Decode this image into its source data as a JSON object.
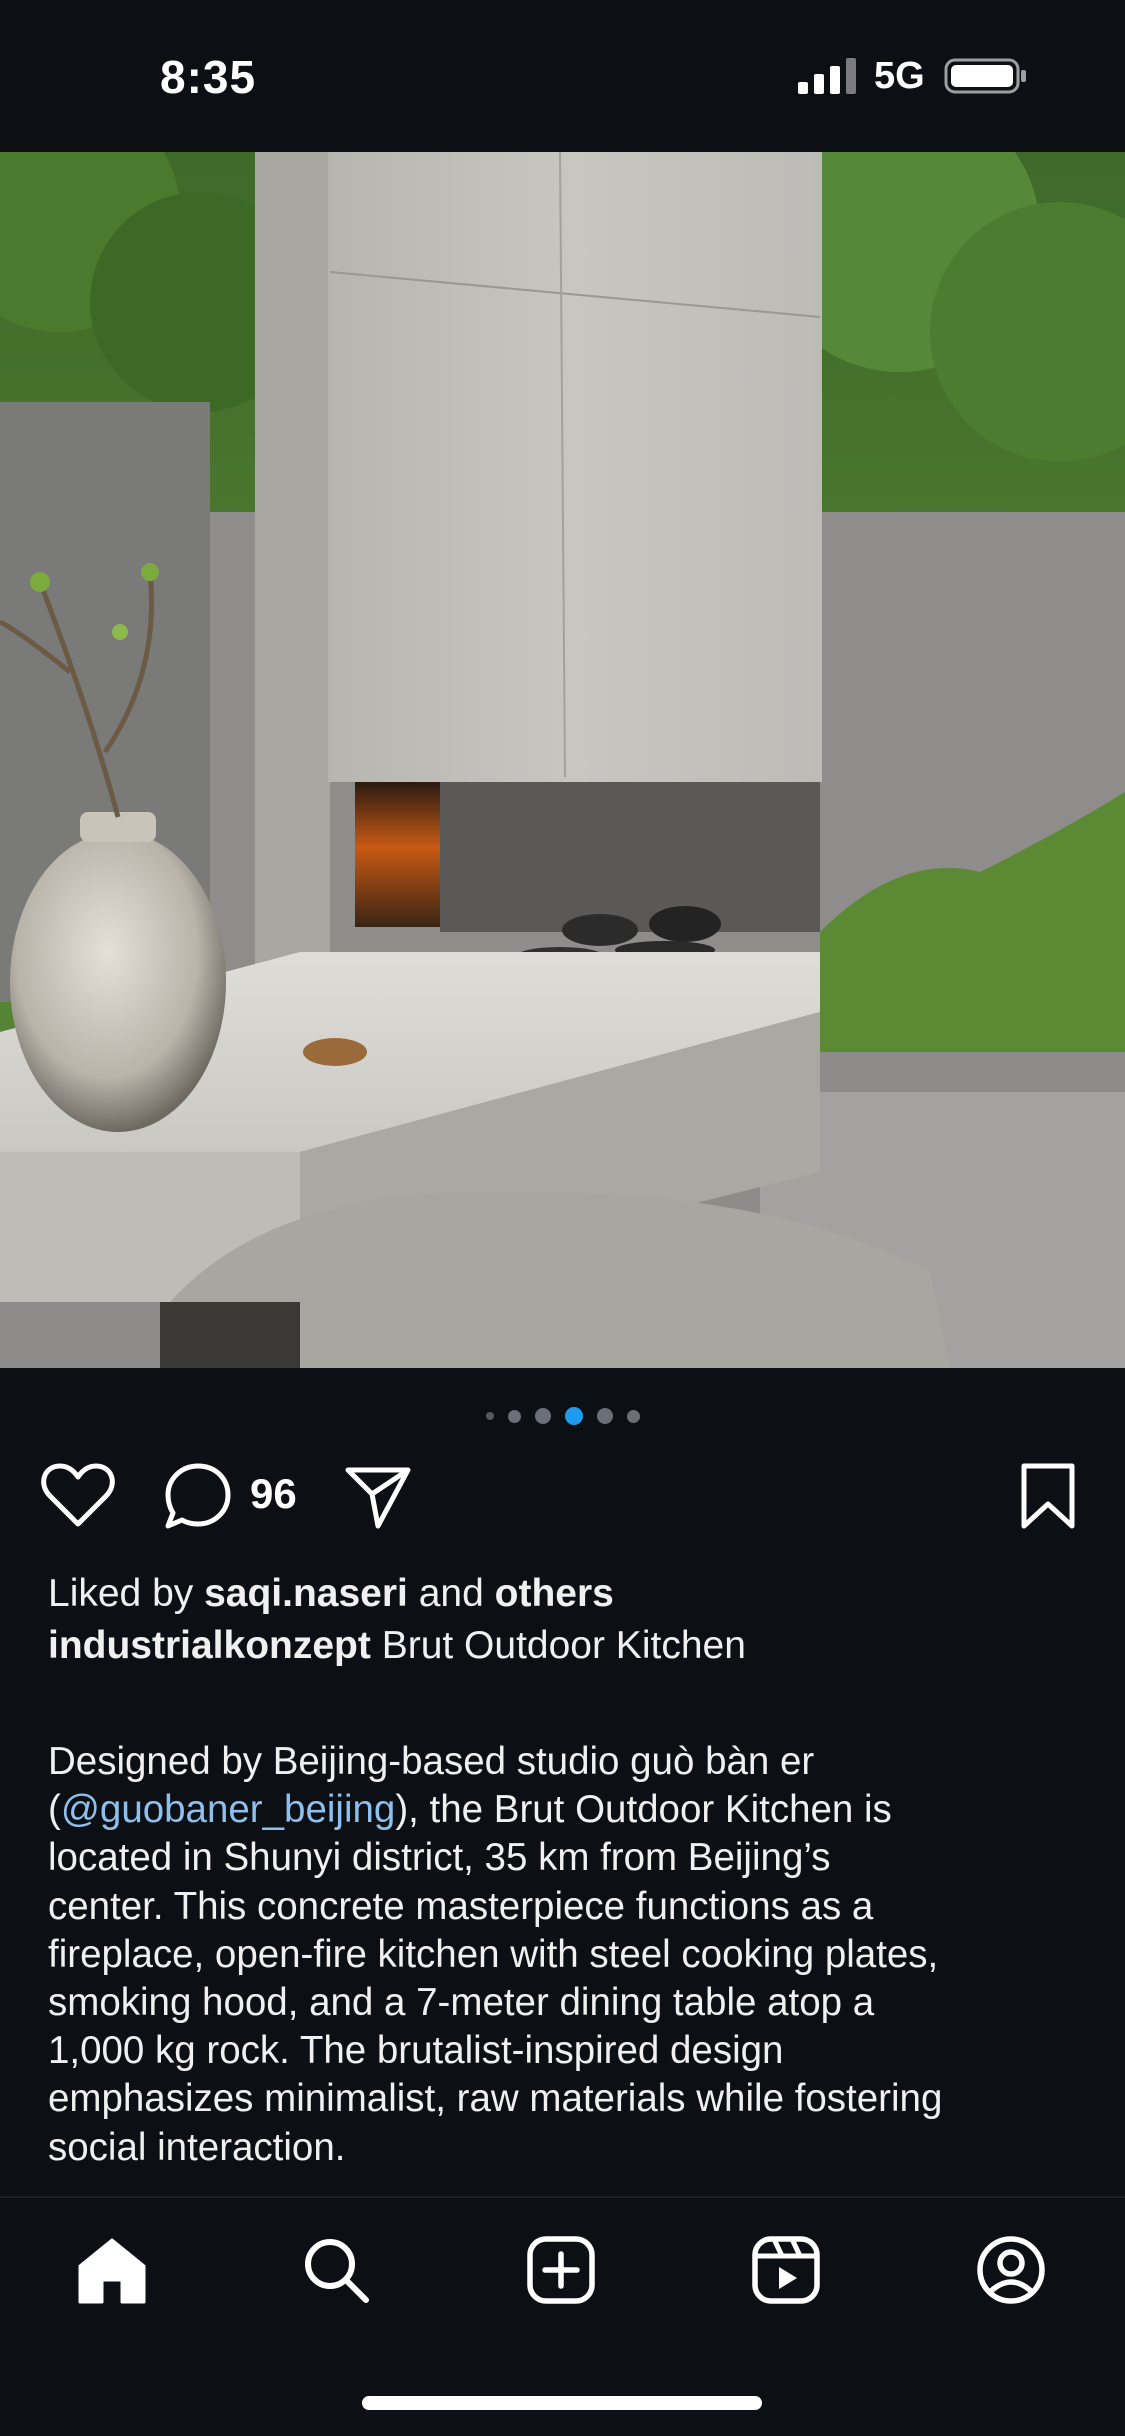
{
  "status_bar": {
    "time": "8:35",
    "network": "5G"
  },
  "carousel": {
    "total": 6,
    "active_index": 3
  },
  "actions": {
    "comment_count": "96"
  },
  "likes": {
    "prefix": "Liked by ",
    "user": "saqi.naseri",
    "middle": " and ",
    "suffix": "others"
  },
  "caption": {
    "username": "industrialkonzept",
    "title": " Brut Outdoor Kitchen",
    "lines": [
      "Designed by Beijing-based studio guò bàn er",
      "(",
      "@guobaner_beijing",
      "), the Brut Outdoor Kitchen is",
      "located in Shunyi district, 35 km from Beijing’s",
      "center. This concrete masterpiece functions as a",
      "fireplace, open-fire kitchen with steel cooking plates,",
      "smoking hood, and a 7-meter dining table atop a",
      "1,000 kg rock. The brutalist-inspired design",
      "emphasizes minimalist, raw materials while fostering",
      "social interaction."
    ]
  },
  "nav": {
    "items": [
      "home",
      "search",
      "create",
      "reels",
      "profile"
    ]
  },
  "colors": {
    "background": "#0c0f14",
    "active_dot": "#1d9bf0",
    "mention": "#8fbfec"
  }
}
